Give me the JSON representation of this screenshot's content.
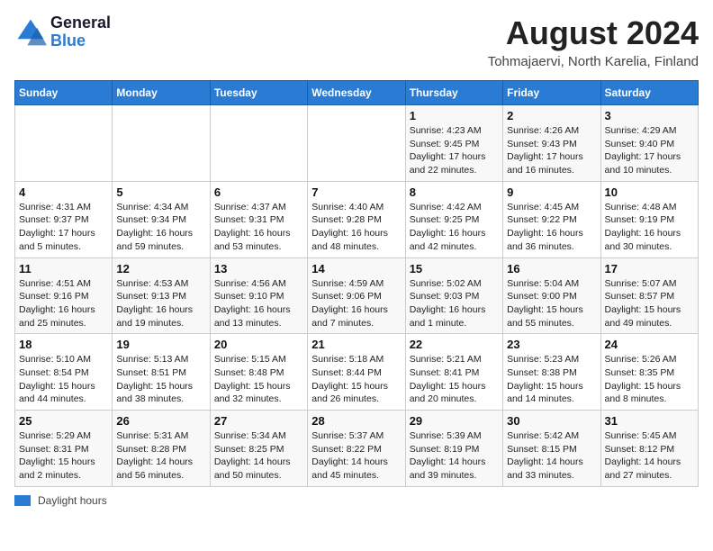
{
  "header": {
    "logo_line1": "General",
    "logo_line2": "Blue",
    "main_title": "August 2024",
    "subtitle": "Tohmajaervi, North Karelia, Finland"
  },
  "calendar": {
    "days_of_week": [
      "Sunday",
      "Monday",
      "Tuesday",
      "Wednesday",
      "Thursday",
      "Friday",
      "Saturday"
    ],
    "weeks": [
      [
        {
          "day": "",
          "info": ""
        },
        {
          "day": "",
          "info": ""
        },
        {
          "day": "",
          "info": ""
        },
        {
          "day": "",
          "info": ""
        },
        {
          "day": "1",
          "info": "Sunrise: 4:23 AM\nSunset: 9:45 PM\nDaylight: 17 hours\nand 22 minutes."
        },
        {
          "day": "2",
          "info": "Sunrise: 4:26 AM\nSunset: 9:43 PM\nDaylight: 17 hours\nand 16 minutes."
        },
        {
          "day": "3",
          "info": "Sunrise: 4:29 AM\nSunset: 9:40 PM\nDaylight: 17 hours\nand 10 minutes."
        }
      ],
      [
        {
          "day": "4",
          "info": "Sunrise: 4:31 AM\nSunset: 9:37 PM\nDaylight: 17 hours\nand 5 minutes."
        },
        {
          "day": "5",
          "info": "Sunrise: 4:34 AM\nSunset: 9:34 PM\nDaylight: 16 hours\nand 59 minutes."
        },
        {
          "day": "6",
          "info": "Sunrise: 4:37 AM\nSunset: 9:31 PM\nDaylight: 16 hours\nand 53 minutes."
        },
        {
          "day": "7",
          "info": "Sunrise: 4:40 AM\nSunset: 9:28 PM\nDaylight: 16 hours\nand 48 minutes."
        },
        {
          "day": "8",
          "info": "Sunrise: 4:42 AM\nSunset: 9:25 PM\nDaylight: 16 hours\nand 42 minutes."
        },
        {
          "day": "9",
          "info": "Sunrise: 4:45 AM\nSunset: 9:22 PM\nDaylight: 16 hours\nand 36 minutes."
        },
        {
          "day": "10",
          "info": "Sunrise: 4:48 AM\nSunset: 9:19 PM\nDaylight: 16 hours\nand 30 minutes."
        }
      ],
      [
        {
          "day": "11",
          "info": "Sunrise: 4:51 AM\nSunset: 9:16 PM\nDaylight: 16 hours\nand 25 minutes."
        },
        {
          "day": "12",
          "info": "Sunrise: 4:53 AM\nSunset: 9:13 PM\nDaylight: 16 hours\nand 19 minutes."
        },
        {
          "day": "13",
          "info": "Sunrise: 4:56 AM\nSunset: 9:10 PM\nDaylight: 16 hours\nand 13 minutes."
        },
        {
          "day": "14",
          "info": "Sunrise: 4:59 AM\nSunset: 9:06 PM\nDaylight: 16 hours\nand 7 minutes."
        },
        {
          "day": "15",
          "info": "Sunrise: 5:02 AM\nSunset: 9:03 PM\nDaylight: 16 hours\nand 1 minute."
        },
        {
          "day": "16",
          "info": "Sunrise: 5:04 AM\nSunset: 9:00 PM\nDaylight: 15 hours\nand 55 minutes."
        },
        {
          "day": "17",
          "info": "Sunrise: 5:07 AM\nSunset: 8:57 PM\nDaylight: 15 hours\nand 49 minutes."
        }
      ],
      [
        {
          "day": "18",
          "info": "Sunrise: 5:10 AM\nSunset: 8:54 PM\nDaylight: 15 hours\nand 44 minutes."
        },
        {
          "day": "19",
          "info": "Sunrise: 5:13 AM\nSunset: 8:51 PM\nDaylight: 15 hours\nand 38 minutes."
        },
        {
          "day": "20",
          "info": "Sunrise: 5:15 AM\nSunset: 8:48 PM\nDaylight: 15 hours\nand 32 minutes."
        },
        {
          "day": "21",
          "info": "Sunrise: 5:18 AM\nSunset: 8:44 PM\nDaylight: 15 hours\nand 26 minutes."
        },
        {
          "day": "22",
          "info": "Sunrise: 5:21 AM\nSunset: 8:41 PM\nDaylight: 15 hours\nand 20 minutes."
        },
        {
          "day": "23",
          "info": "Sunrise: 5:23 AM\nSunset: 8:38 PM\nDaylight: 15 hours\nand 14 minutes."
        },
        {
          "day": "24",
          "info": "Sunrise: 5:26 AM\nSunset: 8:35 PM\nDaylight: 15 hours\nand 8 minutes."
        }
      ],
      [
        {
          "day": "25",
          "info": "Sunrise: 5:29 AM\nSunset: 8:31 PM\nDaylight: 15 hours\nand 2 minutes."
        },
        {
          "day": "26",
          "info": "Sunrise: 5:31 AM\nSunset: 8:28 PM\nDaylight: 14 hours\nand 56 minutes."
        },
        {
          "day": "27",
          "info": "Sunrise: 5:34 AM\nSunset: 8:25 PM\nDaylight: 14 hours\nand 50 minutes."
        },
        {
          "day": "28",
          "info": "Sunrise: 5:37 AM\nSunset: 8:22 PM\nDaylight: 14 hours\nand 45 minutes."
        },
        {
          "day": "29",
          "info": "Sunrise: 5:39 AM\nSunset: 8:19 PM\nDaylight: 14 hours\nand 39 minutes."
        },
        {
          "day": "30",
          "info": "Sunrise: 5:42 AM\nSunset: 8:15 PM\nDaylight: 14 hours\nand 33 minutes."
        },
        {
          "day": "31",
          "info": "Sunrise: 5:45 AM\nSunset: 8:12 PM\nDaylight: 14 hours\nand 27 minutes."
        }
      ]
    ]
  },
  "legend": {
    "label": "Daylight hours"
  }
}
